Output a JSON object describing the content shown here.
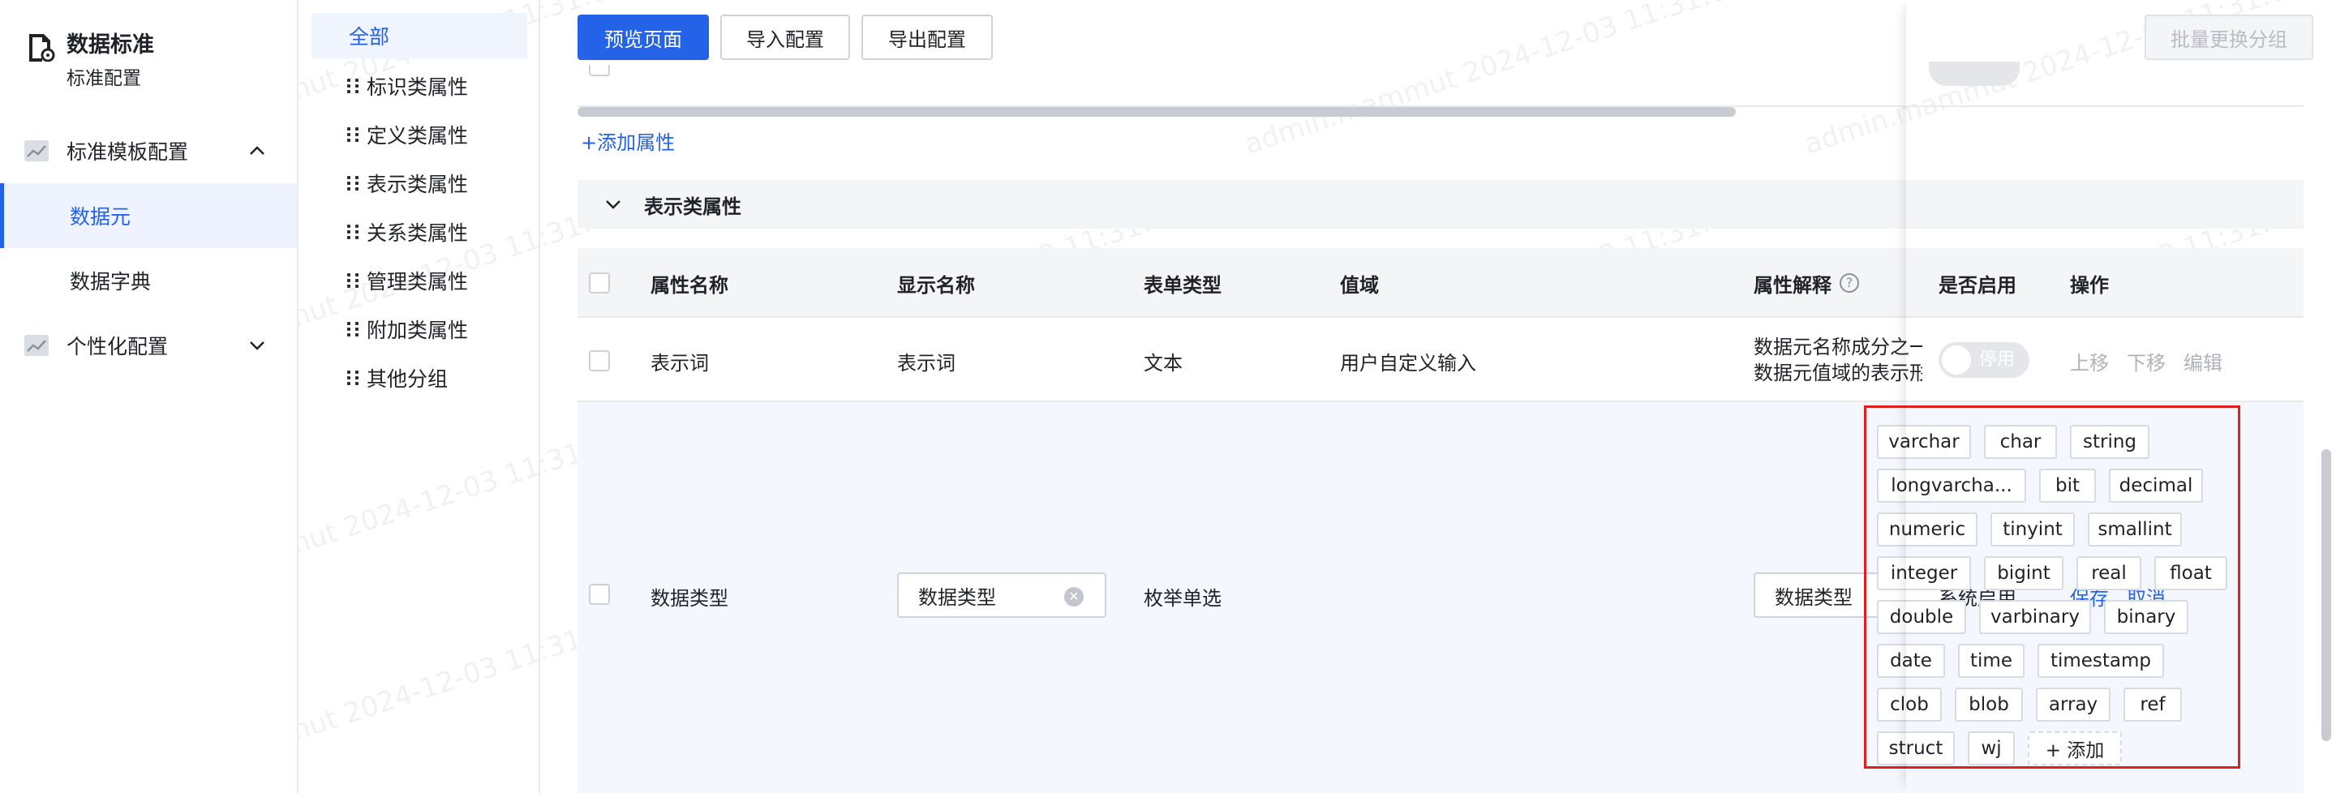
{
  "brand": {
    "title": "数据标准",
    "subtitle": "标准配置"
  },
  "sidebar": {
    "groups": [
      {
        "label": "标准模板配置",
        "expanded": true,
        "items": [
          {
            "label": "数据元",
            "active": true
          },
          {
            "label": "数据字典",
            "active": false
          }
        ]
      },
      {
        "label": "个性化配置",
        "expanded": false
      }
    ]
  },
  "group_nav": {
    "items": [
      {
        "label": "全部",
        "active": true
      },
      {
        "label": "标识类属性"
      },
      {
        "label": "定义类属性"
      },
      {
        "label": "表示类属性"
      },
      {
        "label": "关系类属性"
      },
      {
        "label": "管理类属性"
      },
      {
        "label": "附加类属性"
      },
      {
        "label": "其他分组"
      }
    ]
  },
  "toolbar": {
    "preview": "预览页面",
    "import": "导入配置",
    "export": "导出配置",
    "batch_group": "批量更换分组"
  },
  "add_attribute": "+添加属性",
  "section": {
    "title": "表示类属性"
  },
  "table": {
    "columns": {
      "attr_name": "属性名称",
      "display_name": "显示名称",
      "form_type": "表单类型",
      "value_domain": "值域",
      "attr_desc": "属性解释",
      "enabled": "是否启用",
      "actions": "操作"
    },
    "rows": [
      {
        "attr_name": "表示词",
        "display_name": "表示词",
        "form_type": "文本",
        "value_domain": "用户自定义输入",
        "desc_line1": "数据元名称成分之一",
        "desc_line2": "数据元值域的表示形",
        "toggle_label": "停用",
        "actions": [
          "上移",
          "下移",
          "编辑"
        ]
      },
      {
        "attr_name": "数据类型",
        "display_name_input": "数据类型",
        "form_type": "枚举单选",
        "value_tags": [
          [
            "varchar",
            "char",
            "string"
          ],
          [
            "longvarcha...",
            "bit",
            "decimal"
          ],
          [
            "numeric",
            "tinyint",
            "smallint"
          ],
          [
            "integer",
            "bigint",
            "real",
            "float"
          ],
          [
            "double",
            "varbinary",
            "binary"
          ],
          [
            "date",
            "time",
            "timestamp"
          ],
          [
            "clob",
            "blob",
            "array",
            "ref"
          ],
          [
            "struct",
            "wj"
          ]
        ],
        "add_tag_label": "+ 添加",
        "desc_input": "数据类型",
        "enabled_text": "系统启用",
        "actions": [
          "保存",
          "取消"
        ]
      }
    ]
  },
  "watermark": "admin.mammut 2024-12-03 11:31:02",
  "colors": {
    "primary": "#2462e8",
    "highlight_border": "#e02020",
    "header_bg": "#f4f5f7"
  }
}
